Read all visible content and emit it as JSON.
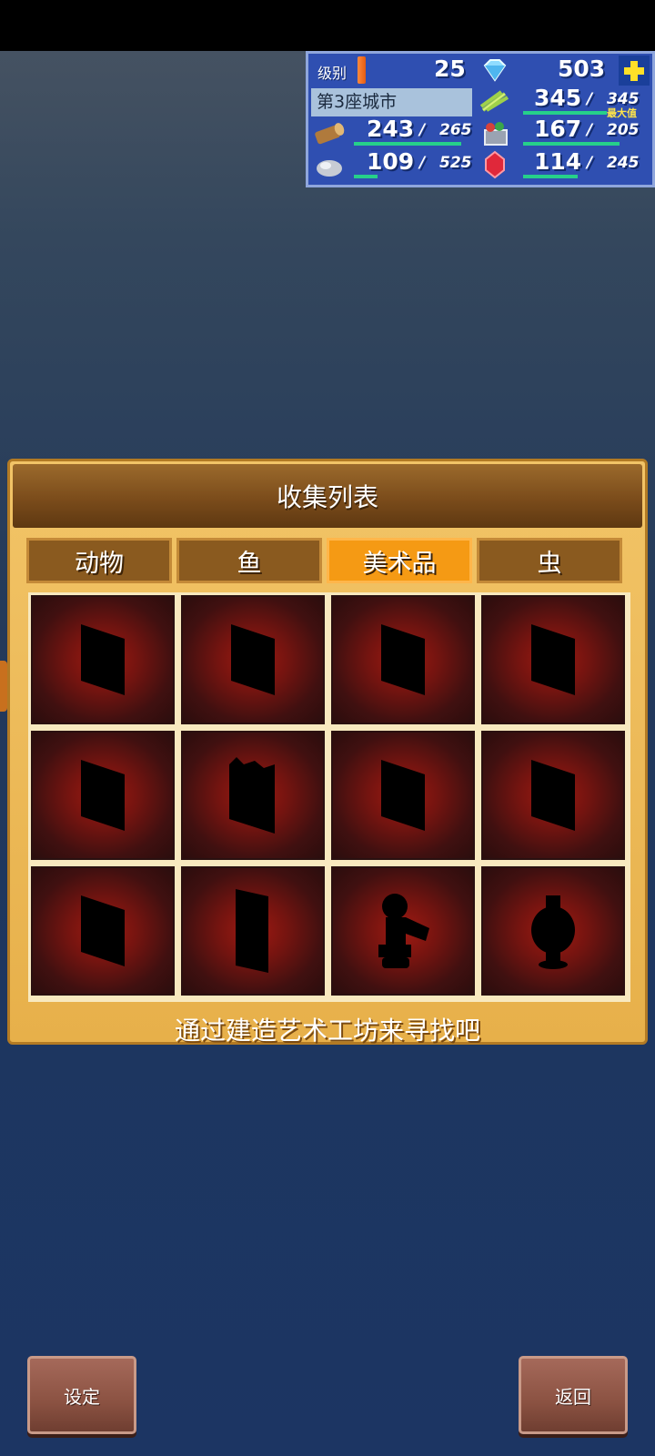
{
  "hud": {
    "level_label": "级别",
    "level": "25",
    "gems": "503",
    "city": "第3座城市",
    "food": "345",
    "food_max": "345",
    "food_max_note": "最大值",
    "wood": "243",
    "wood_max": "265",
    "meat": "167",
    "meat_max": "205",
    "stone": "109",
    "stone_max": "525",
    "ruby": "114",
    "ruby_max": "245",
    "separator": "/"
  },
  "panel": {
    "title": "收集列表",
    "tabs": [
      {
        "label": "动物"
      },
      {
        "label": "鱼"
      },
      {
        "label": "美术品"
      },
      {
        "label": "虫"
      }
    ],
    "active_tab": "美术品",
    "hint": "通过建造艺术工坊来寻找吧"
  },
  "buttons": {
    "settings": "设定",
    "back": "返回"
  },
  "colors": {
    "hud_bg": "#2f4fb1",
    "tab_active": "#f59a14",
    "tab_inactive": "#8a5a1f",
    "bar_green": "#26d08a"
  }
}
